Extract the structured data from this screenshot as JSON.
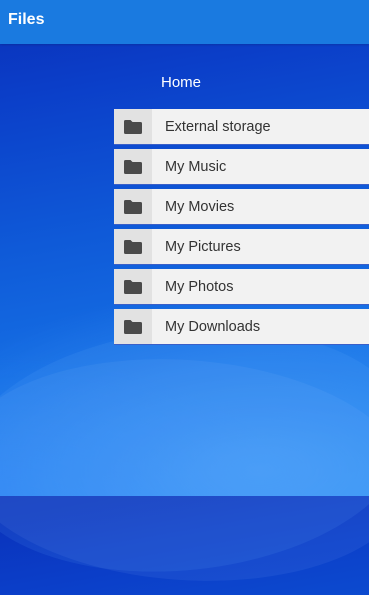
{
  "app": {
    "title": "Files"
  },
  "section": {
    "title": "Home"
  },
  "folders": [
    {
      "label": "External storage",
      "icon": "folder-icon"
    },
    {
      "label": "My Music",
      "icon": "folder-icon"
    },
    {
      "label": "My Movies",
      "icon": "folder-icon"
    },
    {
      "label": "My Pictures",
      "icon": "folder-icon"
    },
    {
      "label": "My Photos",
      "icon": "folder-icon"
    },
    {
      "label": "My Downloads",
      "icon": "folder-icon"
    }
  ],
  "colors": {
    "header": "#1a7ae0",
    "list_bg": "#f2f2f2",
    "icon_cell_bg": "#e2e2e2",
    "folder_icon": "#4a4a4a",
    "text": "#333333"
  }
}
